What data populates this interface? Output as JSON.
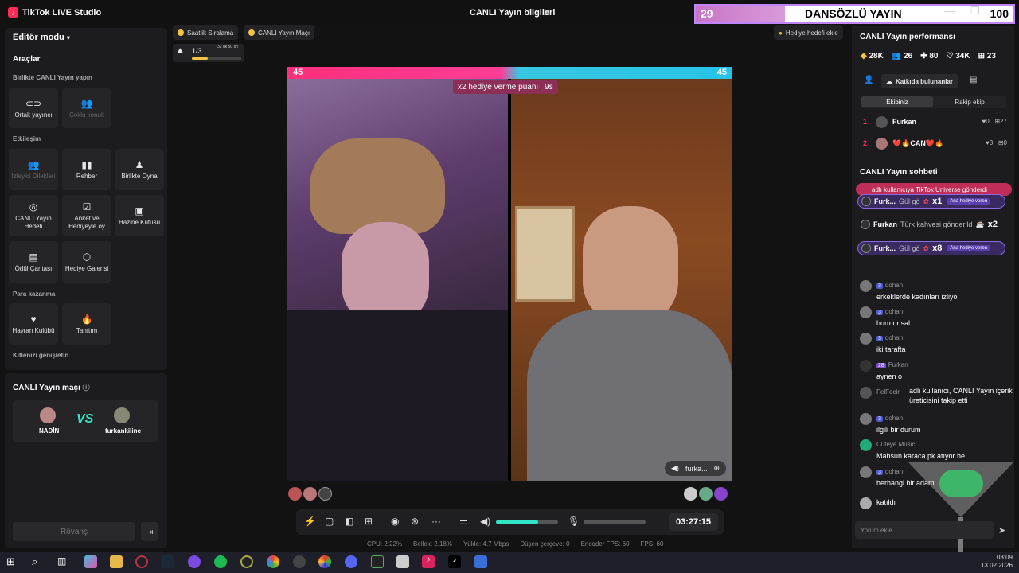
{
  "titlebar": {
    "app_title": "TikTok LIVE Studio",
    "stream_info": "CANLI Yayın bilgileri",
    "overlay_left_num": "29",
    "overlay_text": "DANSÖZLÜ YAYIN",
    "overlay_hidden_text": "LI Yayı",
    "overlay_right_num": "100"
  },
  "left": {
    "editor_mode": "Editör modu",
    "tools_title": "Araçlar",
    "section_coop": "Birlikte CANLI Yayın yapın",
    "section_interaction": "Etkileşim",
    "section_money": "Para kazanma",
    "section_audience": "Kitlenizi genişletin",
    "tools": {
      "cohost": "Ortak yayıncı",
      "multi_guest": "Çoklu konuk",
      "viewer_requests": "İzleyici Dilekleri",
      "guide": "Rehber",
      "play_together": "Birlikte Oyna",
      "live_goal": "CANLI Yayın Hedefi",
      "poll": "Anket ve Hediyeyle oy",
      "treasure": "Hazine Kutusu",
      "reward_bag": "Ödül Çantası",
      "gift_gallery": "Hediye Galerisi",
      "fan_club": "Hayran Kulübü",
      "promote": "Tanıtım"
    },
    "match_title": "CANLI Yayın maçı",
    "player1": "NADİN",
    "player2": "furkankilinc",
    "vs": "VS",
    "rematch": "Rövanş"
  },
  "center": {
    "chip_hourly": "Saatlik Sıralama",
    "chip_match": "CANLI Yayın Maçı",
    "chip_gift_goal": "Hediye hedefi ekle",
    "progress_label": "1/3",
    "progress_time": "32 dk 50 sn",
    "progress_fraction": 0.33,
    "score_left": "45",
    "score_right": "45",
    "bonus_label": "x2 hediye verme puanı",
    "bonus_timer": "9s",
    "guest_name": "furka...",
    "timer": "03:27:15",
    "volume_level": 0.68,
    "stats": {
      "cpu": "CPU:  2.22%",
      "memory": "Bellek:  2.18%",
      "upload": "Yükle:  4.7 Mbps",
      "dropped": "Düşen çerçeve:  0",
      "encoder_fps": "Encoder FPS:  60",
      "fps": "FPS:  60"
    }
  },
  "right": {
    "perf_title": "CANLI Yayın performansı",
    "perf": {
      "diamonds": "28K",
      "viewers": "26",
      "new": "80",
      "likes": "34K",
      "gifts": "23"
    },
    "contributors": "Katkıda bulunanlar",
    "tab_team": "Ekibiniz",
    "tab_rival": "Rakip ekip",
    "rank": [
      {
        "num": "1",
        "name": "Furkan",
        "hearts": "0",
        "gifts": "27"
      },
      {
        "num": "2",
        "name": "❤️🔥CAN❤️🔥",
        "hearts": "3",
        "gifts": "0"
      }
    ],
    "chat_title": "CANLI Yayın sohbeti",
    "gift_banner": "adlı kullanıcıya TikTok Universe gönderdi",
    "gift_rows": [
      {
        "name": "Furk...",
        "msg": "Gül gö",
        "mult": "x1",
        "badge": "Ana hediye veren"
      },
      {
        "name": "Furkan",
        "msg": "Türk kahvesi gönderild",
        "mult": "x2",
        "badge": ""
      },
      {
        "name": "Furk...",
        "msg": "Gül gö",
        "mult": "x8",
        "badge": "Ana hediye veren"
      }
    ],
    "messages": [
      {
        "user": "dohan",
        "level": "3",
        "text": "erkeklerde kadınları izliyo"
      },
      {
        "user": "dohan",
        "level": "3",
        "text": "hormonsal"
      },
      {
        "user": "dohan",
        "level": "3",
        "text": "iki tarafta"
      },
      {
        "user": "Furkan",
        "level": "28",
        "text": "aynen o"
      },
      {
        "user": "FelFecir",
        "level": "",
        "text": "adlı kullanıcı, CANLI Yayın içerik üreticisini takip etti"
      },
      {
        "user": "dohan",
        "level": "3",
        "text": "ilgili bir durum"
      },
      {
        "user": "Cuteye Music",
        "level": "",
        "text": "Mahsun karaca pk atıyor he"
      },
      {
        "user": "dohan",
        "level": "3",
        "text": "herhangi bir adam"
      },
      {
        "user": "",
        "level": "",
        "text": "katıldı"
      }
    ],
    "comment_placeholder": "Yorum ekle"
  },
  "taskbar": {
    "time": "03:09",
    "date": "13.02.2026"
  }
}
